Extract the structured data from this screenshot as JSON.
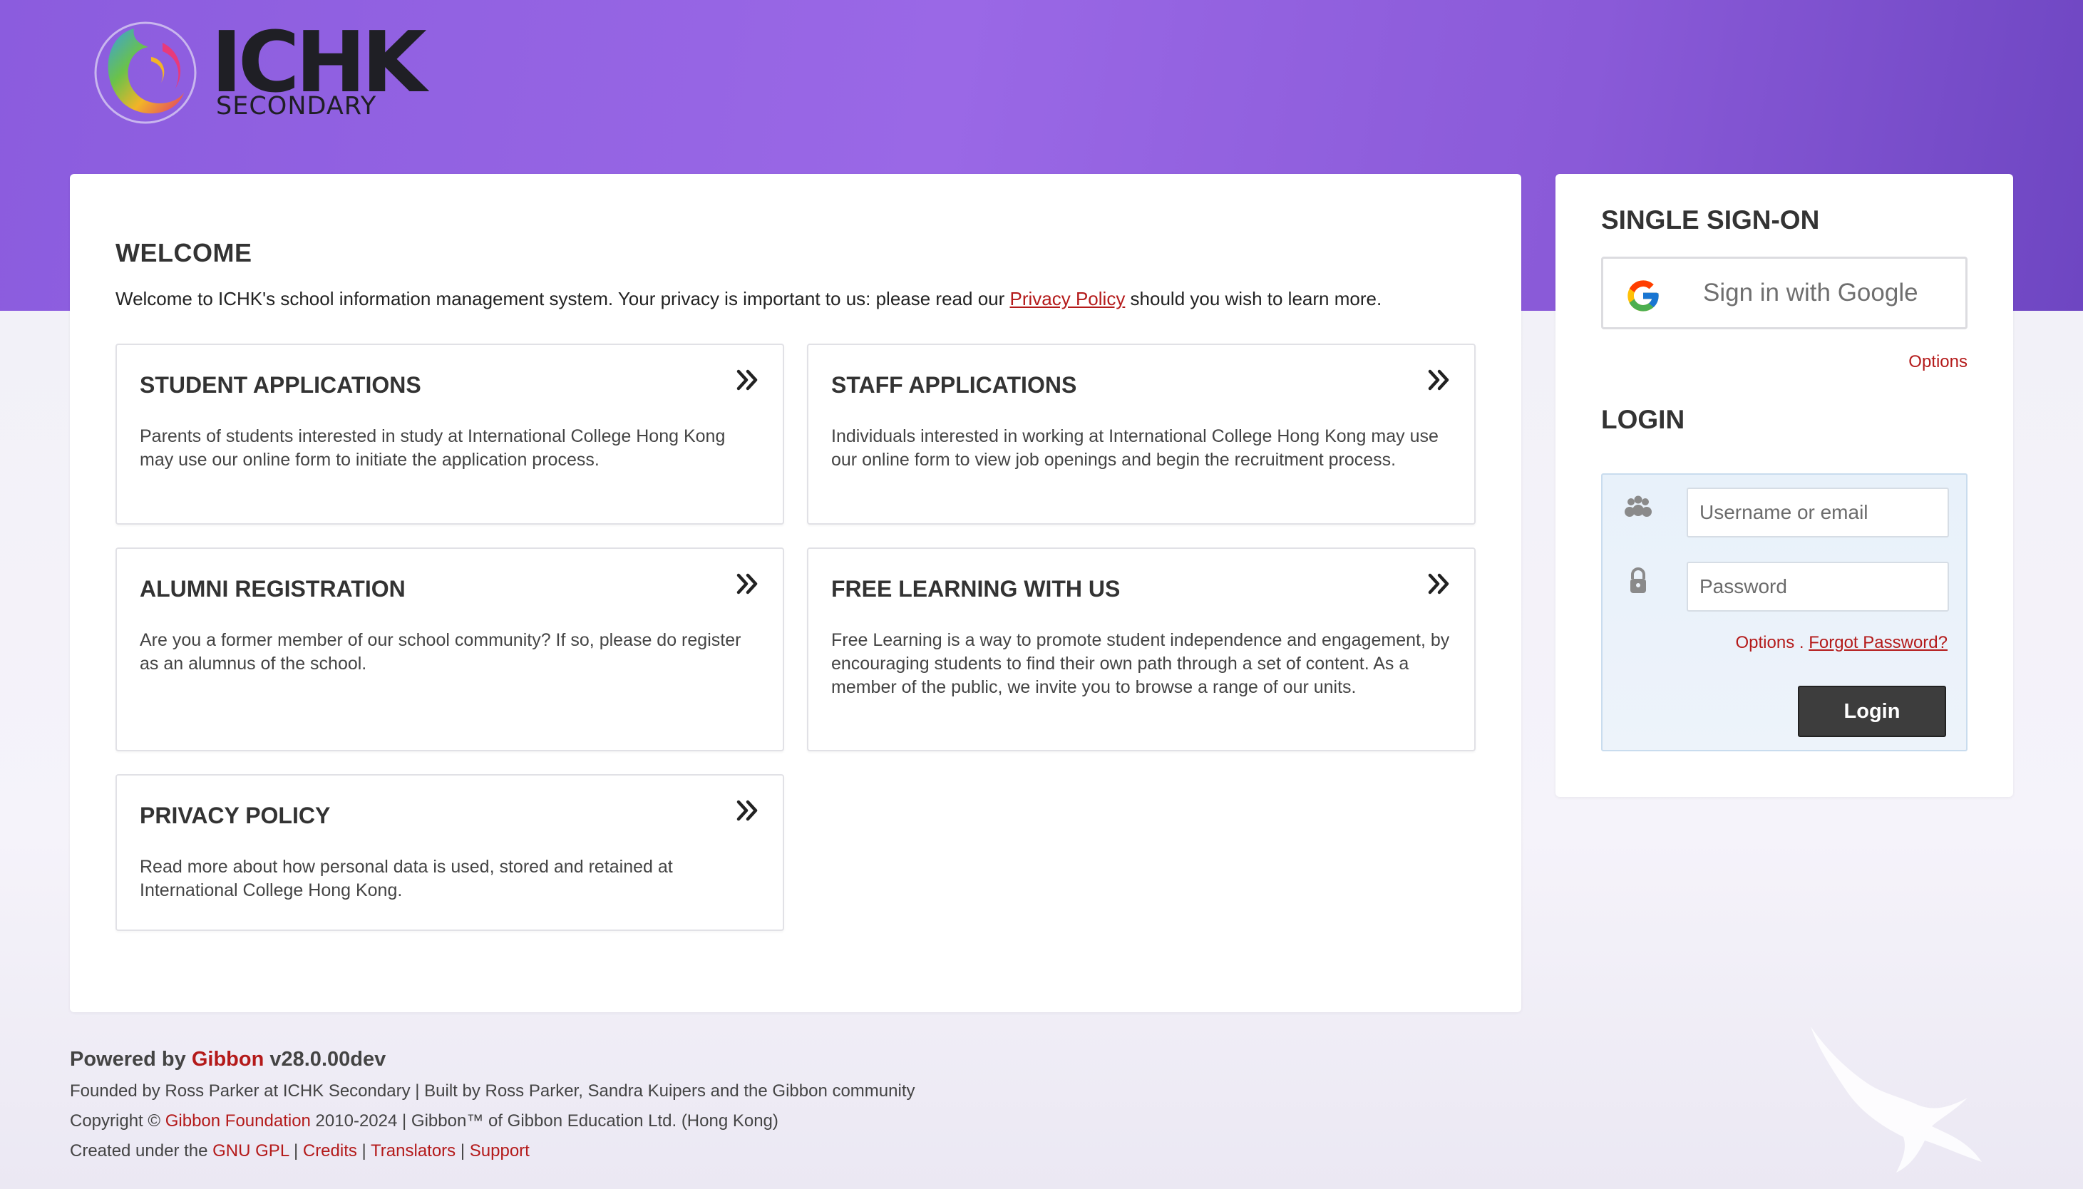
{
  "logo": {
    "main": "ICHK",
    "sub": "SECONDARY"
  },
  "welcome": {
    "title": "WELCOME",
    "text_before": "Welcome to ICHK's school information management system. Your privacy is important to us: please read our ",
    "link": "Privacy Policy",
    "text_after": " should you wish to learn more."
  },
  "cards": [
    {
      "title": "STUDENT APPLICATIONS",
      "desc": "Parents of students interested in study at International College Hong Kong may use our online form to initiate the application process."
    },
    {
      "title": "STAFF APPLICATIONS",
      "desc": "Individuals interested in working at International College Hong Kong may use our online form to view job openings and begin the recruitment process."
    },
    {
      "title": "ALUMNI REGISTRATION",
      "desc": "Are you a former member of our school community? If so, please do register as an alumnus of the school."
    },
    {
      "title": "FREE LEARNING WITH US",
      "desc": "Free Learning is a way to promote student independence and engagement, by encouraging students to find their own path through a set of content. As a member of the public, we invite you to browse a range of our units."
    },
    {
      "title": "PRIVACY POLICY",
      "desc": "Read more about how personal data is used, stored and retained at International College Hong Kong."
    }
  ],
  "sso": {
    "title": "SINGLE SIGN-ON",
    "google_label": "Sign in with Google",
    "options": "Options"
  },
  "login": {
    "title": "LOGIN",
    "username_placeholder": "Username or email",
    "password_placeholder": "Password",
    "options": "Options",
    "separator": " . ",
    "forgot": "Forgot Password?",
    "button": "Login"
  },
  "footer": {
    "powered_by": "Powered by ",
    "gibbon": "Gibbon",
    "version": " v28.0.00dev",
    "founded": "Founded by Ross Parker at ICHK Secondary | Built by Ross Parker, Sandra Kuipers and the Gibbon community",
    "copyright_prefix": "Copyright © ",
    "foundation": "Gibbon Foundation",
    "copyright_suffix": " 2010-2024 | Gibbon™ of Gibbon Education Ltd. (Hong Kong)",
    "created_prefix": "Created under the ",
    "gpl": "GNU GPL",
    "sep": " | ",
    "credits": "Credits",
    "translators": "Translators",
    "support": "Support"
  },
  "colors": {
    "accent": "#b41a1a",
    "band": "#8b5cde",
    "button": "#3d3d3d"
  },
  "icons": [
    "double-chevron-right-icon",
    "google-icon",
    "users-icon",
    "lock-icon"
  ]
}
